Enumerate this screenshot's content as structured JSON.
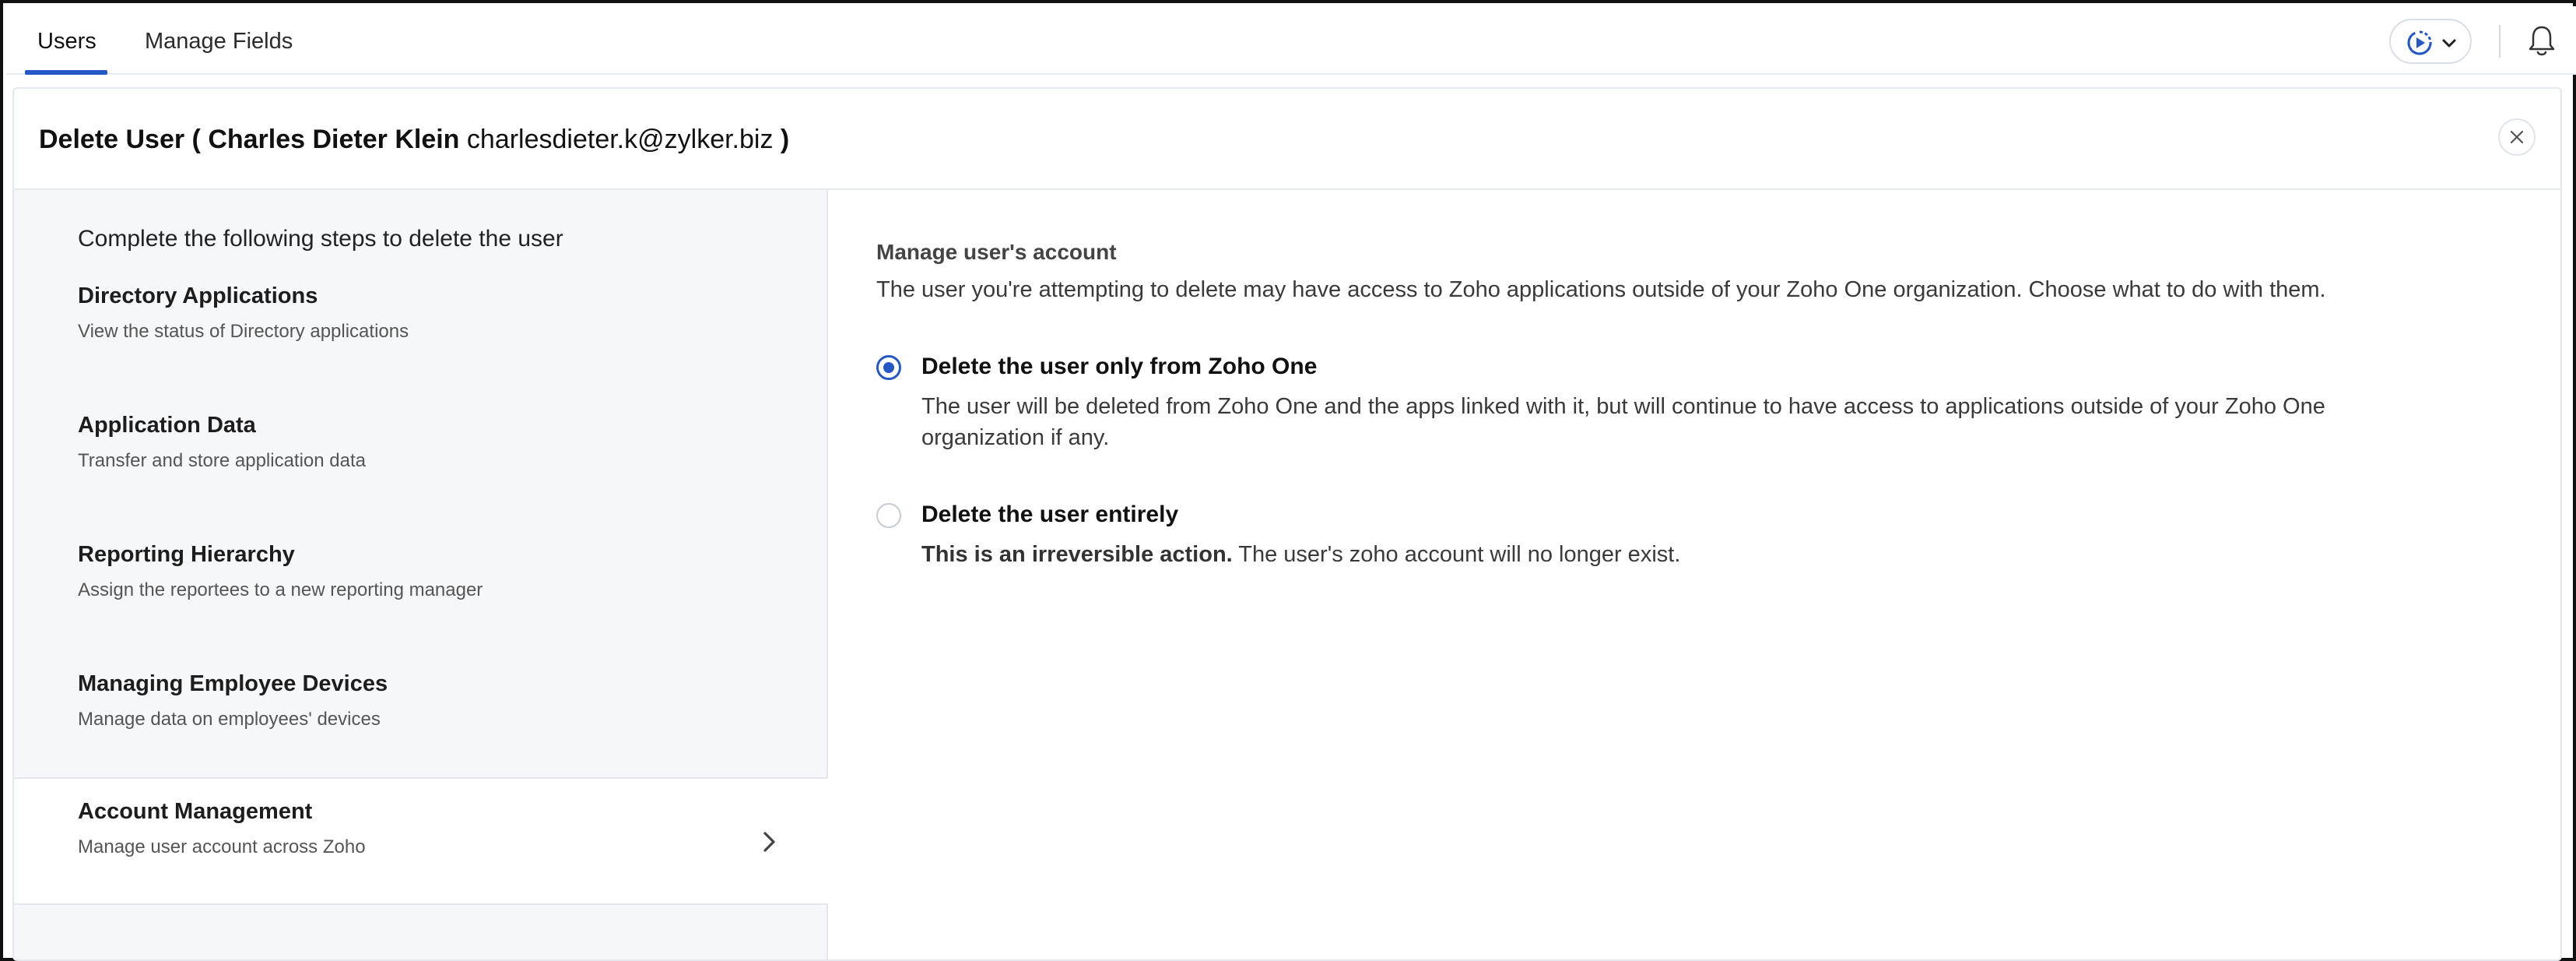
{
  "tabs": [
    {
      "label": "Users",
      "active": true
    },
    {
      "label": "Manage Fields",
      "active": false
    }
  ],
  "header_icons": [
    "play-circle-icon",
    "chevron-down-icon",
    "bell-icon"
  ],
  "accent_color": "#2458c6",
  "dialog": {
    "title_prefix": "Delete User (",
    "user_name": "Charles Dieter Klein",
    "user_email": "charlesdieter.k@zylker.biz",
    "title_suffix": ")"
  },
  "steps": {
    "intro": "Complete the following steps to delete the user",
    "items": [
      {
        "title": "Directory Applications",
        "desc": "View the status of Directory applications"
      },
      {
        "title": "Application Data",
        "desc": "Transfer and store application data"
      },
      {
        "title": "Reporting Hierarchy",
        "desc": "Assign the reportees to a new reporting manager"
      },
      {
        "title": "Managing Employee Devices",
        "desc": "Manage data on employees' devices"
      },
      {
        "title": "Account Management",
        "desc": "Manage user account across Zoho",
        "active": true
      }
    ]
  },
  "content": {
    "title": "Manage user's account",
    "description": "The user you're attempting to delete may have access to Zoho applications outside of your Zoho One organization. Choose what to do with them.",
    "options": [
      {
        "label": "Delete the user only from Zoho One",
        "selected": true,
        "desc": "The user will be deleted from Zoho One and the apps linked with it, but will continue to have access to applications outside of your Zoho One organization if any."
      },
      {
        "label": "Delete the user entirely",
        "selected": false,
        "desc_bold": "This is an irreversible action.",
        "desc": "The user's zoho account will no longer exist."
      }
    ]
  }
}
